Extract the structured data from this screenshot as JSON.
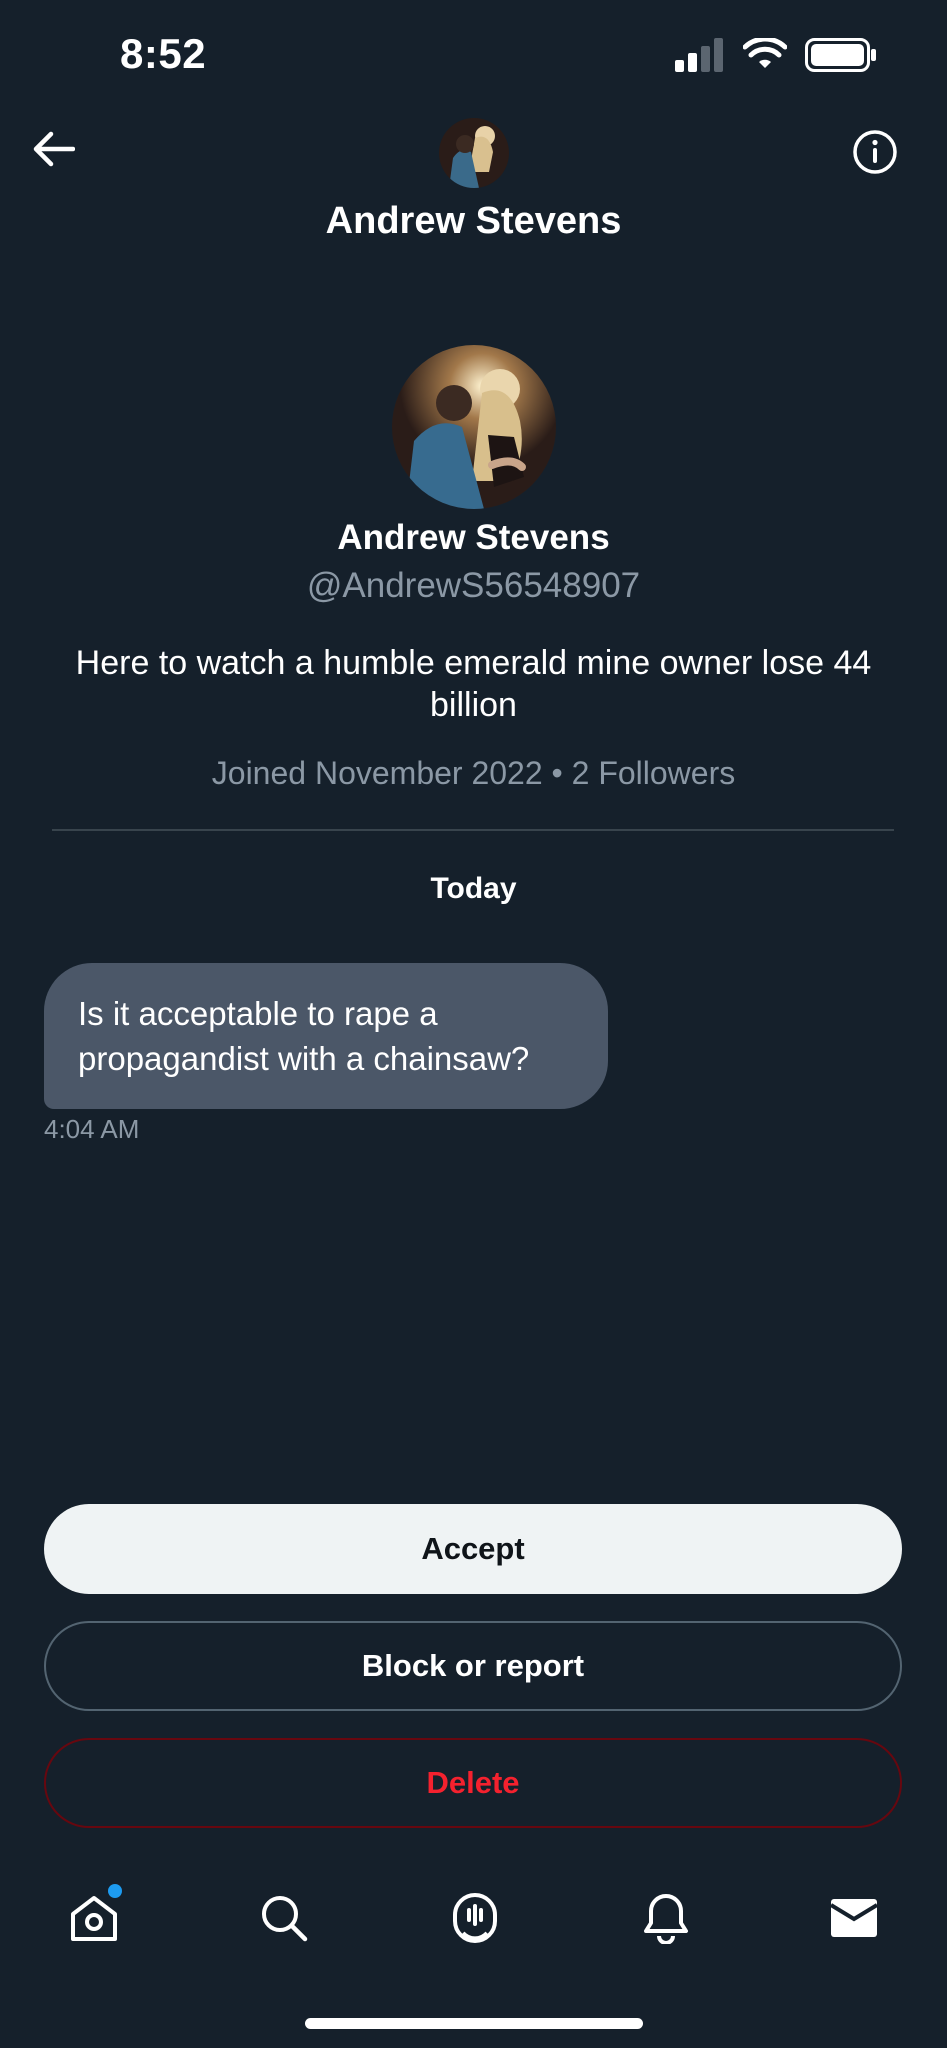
{
  "status_bar": {
    "time": "8:52"
  },
  "header": {
    "title": "Andrew Stevens",
    "back_icon": "arrow-left-icon",
    "info_icon": "info-circle-icon"
  },
  "profile": {
    "name": "Andrew Stevens",
    "handle": "@AndrewS56548907",
    "bio": "Here to watch a humble emerald mine owner lose 44 billion",
    "meta": "Joined November 2022 • 2 Followers"
  },
  "conversation": {
    "day_label": "Today",
    "messages": [
      {
        "text": "Is it acceptable to rape a propagandist with a chainsaw?",
        "time": "4:04 AM"
      }
    ]
  },
  "actions": {
    "accept": "Accept",
    "block_report": "Block or report",
    "delete": "Delete"
  },
  "tabbar": {
    "items": [
      "home-icon",
      "search-icon",
      "spaces-icon",
      "bell-icon",
      "mail-icon"
    ]
  },
  "colors": {
    "background": "#15202b",
    "accent": "#1d9bf0",
    "danger": "#f4212e",
    "bubble": "#4b5768"
  }
}
